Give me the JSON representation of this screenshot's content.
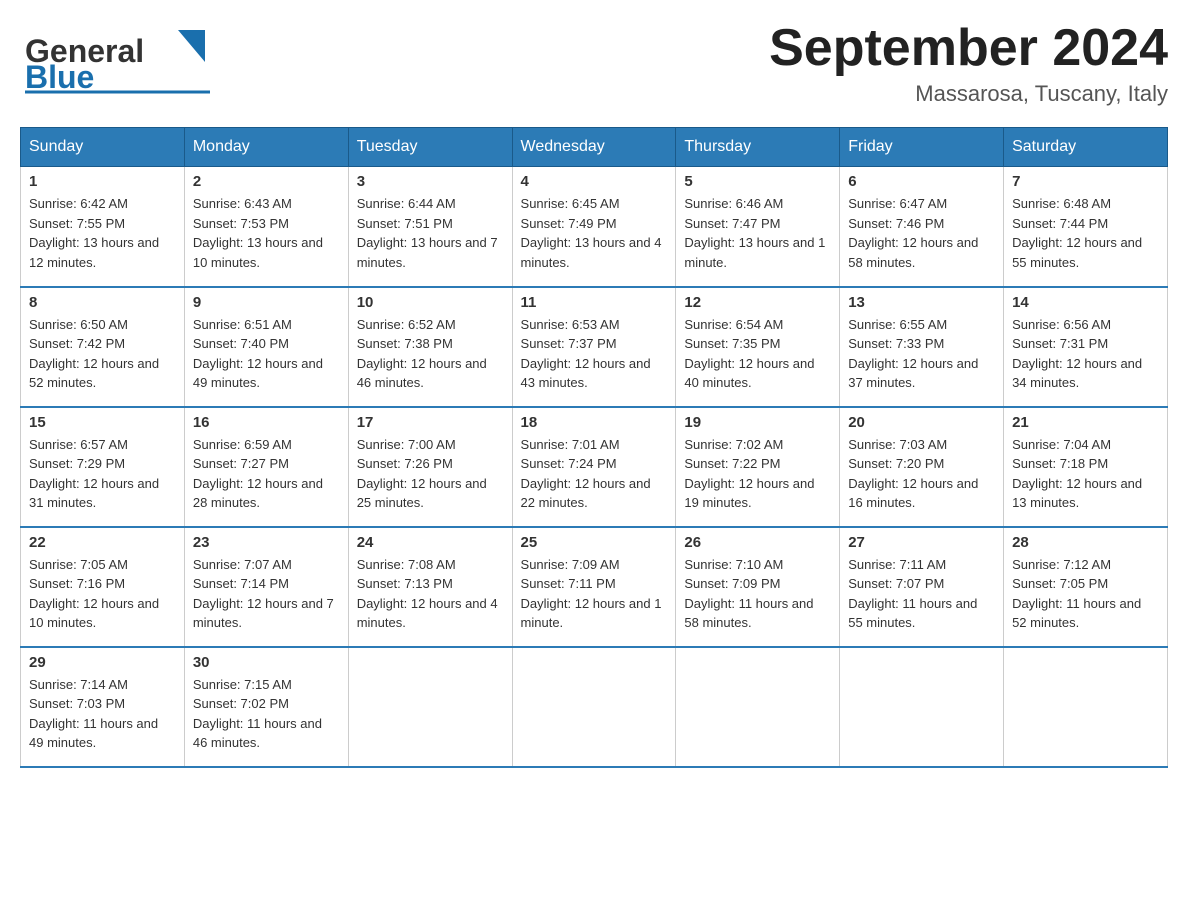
{
  "header": {
    "logo_general": "General",
    "logo_blue": "Blue",
    "month_year": "September 2024",
    "location": "Massarosa, Tuscany, Italy"
  },
  "days_of_week": [
    "Sunday",
    "Monday",
    "Tuesday",
    "Wednesday",
    "Thursday",
    "Friday",
    "Saturday"
  ],
  "weeks": [
    [
      {
        "day": "1",
        "sunrise": "Sunrise: 6:42 AM",
        "sunset": "Sunset: 7:55 PM",
        "daylight": "Daylight: 13 hours and 12 minutes."
      },
      {
        "day": "2",
        "sunrise": "Sunrise: 6:43 AM",
        "sunset": "Sunset: 7:53 PM",
        "daylight": "Daylight: 13 hours and 10 minutes."
      },
      {
        "day": "3",
        "sunrise": "Sunrise: 6:44 AM",
        "sunset": "Sunset: 7:51 PM",
        "daylight": "Daylight: 13 hours and 7 minutes."
      },
      {
        "day": "4",
        "sunrise": "Sunrise: 6:45 AM",
        "sunset": "Sunset: 7:49 PM",
        "daylight": "Daylight: 13 hours and 4 minutes."
      },
      {
        "day": "5",
        "sunrise": "Sunrise: 6:46 AM",
        "sunset": "Sunset: 7:47 PM",
        "daylight": "Daylight: 13 hours and 1 minute."
      },
      {
        "day": "6",
        "sunrise": "Sunrise: 6:47 AM",
        "sunset": "Sunset: 7:46 PM",
        "daylight": "Daylight: 12 hours and 58 minutes."
      },
      {
        "day": "7",
        "sunrise": "Sunrise: 6:48 AM",
        "sunset": "Sunset: 7:44 PM",
        "daylight": "Daylight: 12 hours and 55 minutes."
      }
    ],
    [
      {
        "day": "8",
        "sunrise": "Sunrise: 6:50 AM",
        "sunset": "Sunset: 7:42 PM",
        "daylight": "Daylight: 12 hours and 52 minutes."
      },
      {
        "day": "9",
        "sunrise": "Sunrise: 6:51 AM",
        "sunset": "Sunset: 7:40 PM",
        "daylight": "Daylight: 12 hours and 49 minutes."
      },
      {
        "day": "10",
        "sunrise": "Sunrise: 6:52 AM",
        "sunset": "Sunset: 7:38 PM",
        "daylight": "Daylight: 12 hours and 46 minutes."
      },
      {
        "day": "11",
        "sunrise": "Sunrise: 6:53 AM",
        "sunset": "Sunset: 7:37 PM",
        "daylight": "Daylight: 12 hours and 43 minutes."
      },
      {
        "day": "12",
        "sunrise": "Sunrise: 6:54 AM",
        "sunset": "Sunset: 7:35 PM",
        "daylight": "Daylight: 12 hours and 40 minutes."
      },
      {
        "day": "13",
        "sunrise": "Sunrise: 6:55 AM",
        "sunset": "Sunset: 7:33 PM",
        "daylight": "Daylight: 12 hours and 37 minutes."
      },
      {
        "day": "14",
        "sunrise": "Sunrise: 6:56 AM",
        "sunset": "Sunset: 7:31 PM",
        "daylight": "Daylight: 12 hours and 34 minutes."
      }
    ],
    [
      {
        "day": "15",
        "sunrise": "Sunrise: 6:57 AM",
        "sunset": "Sunset: 7:29 PM",
        "daylight": "Daylight: 12 hours and 31 minutes."
      },
      {
        "day": "16",
        "sunrise": "Sunrise: 6:59 AM",
        "sunset": "Sunset: 7:27 PM",
        "daylight": "Daylight: 12 hours and 28 minutes."
      },
      {
        "day": "17",
        "sunrise": "Sunrise: 7:00 AM",
        "sunset": "Sunset: 7:26 PM",
        "daylight": "Daylight: 12 hours and 25 minutes."
      },
      {
        "day": "18",
        "sunrise": "Sunrise: 7:01 AM",
        "sunset": "Sunset: 7:24 PM",
        "daylight": "Daylight: 12 hours and 22 minutes."
      },
      {
        "day": "19",
        "sunrise": "Sunrise: 7:02 AM",
        "sunset": "Sunset: 7:22 PM",
        "daylight": "Daylight: 12 hours and 19 minutes."
      },
      {
        "day": "20",
        "sunrise": "Sunrise: 7:03 AM",
        "sunset": "Sunset: 7:20 PM",
        "daylight": "Daylight: 12 hours and 16 minutes."
      },
      {
        "day": "21",
        "sunrise": "Sunrise: 7:04 AM",
        "sunset": "Sunset: 7:18 PM",
        "daylight": "Daylight: 12 hours and 13 minutes."
      }
    ],
    [
      {
        "day": "22",
        "sunrise": "Sunrise: 7:05 AM",
        "sunset": "Sunset: 7:16 PM",
        "daylight": "Daylight: 12 hours and 10 minutes."
      },
      {
        "day": "23",
        "sunrise": "Sunrise: 7:07 AM",
        "sunset": "Sunset: 7:14 PM",
        "daylight": "Daylight: 12 hours and 7 minutes."
      },
      {
        "day": "24",
        "sunrise": "Sunrise: 7:08 AM",
        "sunset": "Sunset: 7:13 PM",
        "daylight": "Daylight: 12 hours and 4 minutes."
      },
      {
        "day": "25",
        "sunrise": "Sunrise: 7:09 AM",
        "sunset": "Sunset: 7:11 PM",
        "daylight": "Daylight: 12 hours and 1 minute."
      },
      {
        "day": "26",
        "sunrise": "Sunrise: 7:10 AM",
        "sunset": "Sunset: 7:09 PM",
        "daylight": "Daylight: 11 hours and 58 minutes."
      },
      {
        "day": "27",
        "sunrise": "Sunrise: 7:11 AM",
        "sunset": "Sunset: 7:07 PM",
        "daylight": "Daylight: 11 hours and 55 minutes."
      },
      {
        "day": "28",
        "sunrise": "Sunrise: 7:12 AM",
        "sunset": "Sunset: 7:05 PM",
        "daylight": "Daylight: 11 hours and 52 minutes."
      }
    ],
    [
      {
        "day": "29",
        "sunrise": "Sunrise: 7:14 AM",
        "sunset": "Sunset: 7:03 PM",
        "daylight": "Daylight: 11 hours and 49 minutes."
      },
      {
        "day": "30",
        "sunrise": "Sunrise: 7:15 AM",
        "sunset": "Sunset: 7:02 PM",
        "daylight": "Daylight: 11 hours and 46 minutes."
      },
      null,
      null,
      null,
      null,
      null
    ]
  ]
}
